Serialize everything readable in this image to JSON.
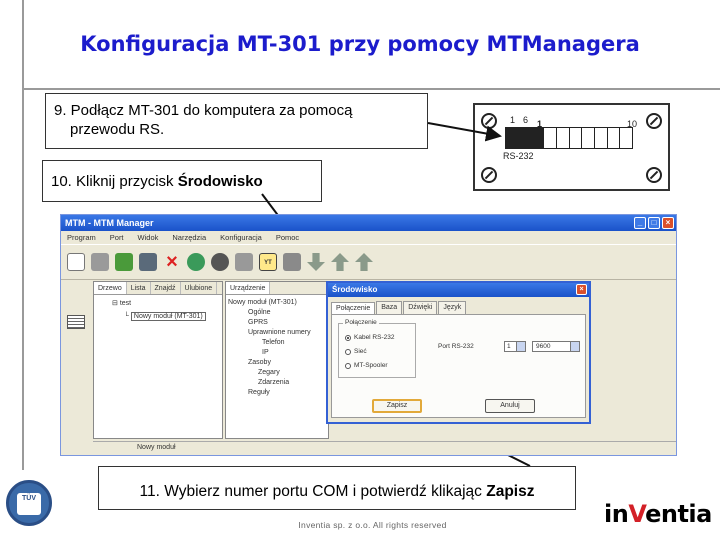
{
  "slide": {
    "title": "Konfiguracja MT-301 przy pomocy MTManagera",
    "footer": "Inventia sp. z o.o. All rights reserved",
    "logo": {
      "prefix": "in",
      "mark": "V",
      "suffix": "entia"
    },
    "certification_badge_text": "TÜV"
  },
  "callouts": {
    "step9_line1": "9. Podłącz MT-301 do komputera za pomocą",
    "step9_line2": "przewodu RS.",
    "step10_prefix": "10. Kliknij przycisk ",
    "step10_bold": "Środowisko",
    "step11_prefix": "11. Wybierz numer portu COM i potwierdź klikając ",
    "step11_bold": "Zapisz"
  },
  "connector": {
    "pin_labels": [
      "1",
      "6",
      "1",
      "10"
    ],
    "label": "RS-232"
  },
  "app": {
    "title": "MTM - MTM Manager",
    "menu": [
      "Program",
      "Port",
      "Widok",
      "Narzędzia",
      "Konfiguracja",
      "Pomoc"
    ],
    "toolbar_icons": [
      "new-icon",
      "open-icon",
      "connect-icon",
      "disconnect-icon",
      "delete-icon",
      "read-icon",
      "write-icon",
      "tool-icon",
      "environment-icon",
      "modem-icon",
      "upload-icon",
      "download-icon",
      "up-icon"
    ],
    "environment_button_label": "YT",
    "left_tabs": [
      "Drzewo",
      "Lista",
      "Znajdź",
      "Ulubione"
    ],
    "tree_items": [
      "test",
      "Nowy moduł (MT-301)"
    ],
    "mid_tabs": [
      "Urządzenie"
    ],
    "mid_items": [
      "Nowy moduł (MT-301)",
      "Ogólne",
      "GPRS",
      "Uprawnione numery",
      "Telefon",
      "IP",
      "Zasoby",
      "Zegary",
      "Zdarzenia",
      "Reguły"
    ],
    "status_text": "Nowy moduł"
  },
  "dialog": {
    "title": "Środowisko",
    "tabs": [
      "Połączenie",
      "Baza",
      "Dźwięki",
      "Język"
    ],
    "group_label": "Połączenie",
    "radio_options": [
      {
        "label": "Kabel RS-232",
        "selected": true
      },
      {
        "label": "Sieć",
        "selected": false
      },
      {
        "label": "MT-Spooler",
        "selected": false
      }
    ],
    "port_label": "Port RS-232",
    "port_value": "1",
    "speed_value": "9600",
    "save_label": "Zapisz",
    "cancel_label": "Anuluj"
  }
}
